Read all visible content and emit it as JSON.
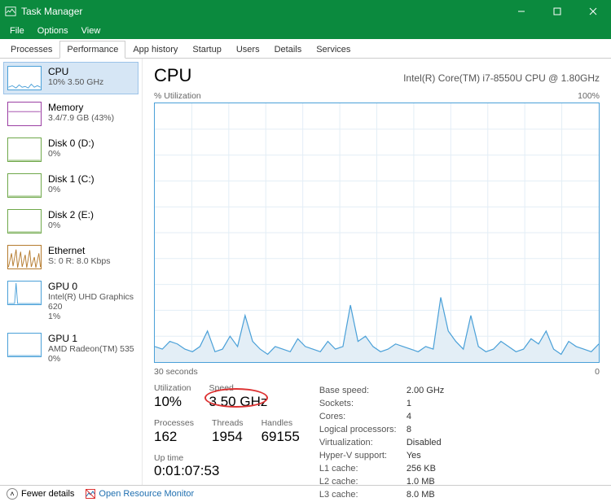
{
  "app_title": "Task Manager",
  "menu": [
    "File",
    "Options",
    "View"
  ],
  "tabs": [
    "Processes",
    "Performance",
    "App history",
    "Startup",
    "Users",
    "Details",
    "Services"
  ],
  "active_tab": 1,
  "sidebar": [
    {
      "title": "CPU",
      "sub": "10% 3.50 GHz",
      "color": "#4aa0d8",
      "selected": true,
      "spark": "cpu"
    },
    {
      "title": "Memory",
      "sub": "3.4/7.9 GB (43%)",
      "color": "#9b3fa3",
      "spark": "mem"
    },
    {
      "title": "Disk 0 (D:)",
      "sub": "0%",
      "color": "#6fa84a",
      "spark": "flat"
    },
    {
      "title": "Disk 1 (C:)",
      "sub": "0%",
      "color": "#6fa84a",
      "spark": "flat"
    },
    {
      "title": "Disk 2 (E:)",
      "sub": "0%",
      "color": "#6fa84a",
      "spark": "flat"
    },
    {
      "title": "Ethernet",
      "sub": "S: 0 R: 8.0 Kbps",
      "color": "#b57b2e",
      "spark": "eth"
    },
    {
      "title": "GPU 0",
      "sub": "Intel(R) UHD Graphics 620\n1%",
      "color": "#4aa0d8",
      "spark": "gpu0"
    },
    {
      "title": "GPU 1",
      "sub": "AMD Radeon(TM) 535\n0%",
      "color": "#4aa0d8",
      "spark": "flat"
    }
  ],
  "panel": {
    "title": "CPU",
    "subtitle": "Intel(R) Core(TM) i7-8550U CPU @ 1.80GHz",
    "util_label": "% Utilization",
    "util_max": "100%",
    "time_left": "30 seconds",
    "time_right": "0",
    "stats_row1": [
      {
        "lbl": "Utilization",
        "val": "10%"
      },
      {
        "lbl": "Speed",
        "val": "3.50 GHz",
        "circled": true
      }
    ],
    "stats_row2": [
      {
        "lbl": "Processes",
        "val": "162"
      },
      {
        "lbl": "Threads",
        "val": "1954"
      },
      {
        "lbl": "Handles",
        "val": "69155"
      }
    ],
    "uptime_lbl": "Up time",
    "uptime_val": "0:01:07:53",
    "right_stats": [
      [
        "Base speed:",
        "2.00 GHz"
      ],
      [
        "Sockets:",
        "1"
      ],
      [
        "Cores:",
        "4"
      ],
      [
        "Logical processors:",
        "8"
      ],
      [
        "Virtualization:",
        "Disabled"
      ],
      [
        "Hyper-V support:",
        "Yes"
      ],
      [
        "L1 cache:",
        "256 KB"
      ],
      [
        "L2 cache:",
        "1.0 MB"
      ],
      [
        "L3 cache:",
        "8.0 MB"
      ]
    ]
  },
  "footer": {
    "fewer": "Fewer details",
    "orm": "Open Resource Monitor"
  },
  "chart_data": {
    "type": "area",
    "title": "% Utilization",
    "ylim": [
      0,
      100
    ],
    "xlabel_left": "30 seconds",
    "xlabel_right": "0",
    "series": [
      {
        "name": "CPU",
        "values": [
          6,
          5,
          8,
          7,
          5,
          4,
          6,
          12,
          4,
          5,
          10,
          6,
          18,
          8,
          5,
          3,
          6,
          5,
          4,
          9,
          6,
          5,
          4,
          8,
          5,
          6,
          22,
          8,
          10,
          6,
          4,
          5,
          7,
          6,
          5,
          4,
          6,
          5,
          25,
          12,
          8,
          5,
          18,
          6,
          4,
          5,
          8,
          6,
          4,
          5,
          9,
          7,
          12,
          5,
          3,
          8,
          6,
          5,
          4,
          7
        ]
      }
    ]
  }
}
